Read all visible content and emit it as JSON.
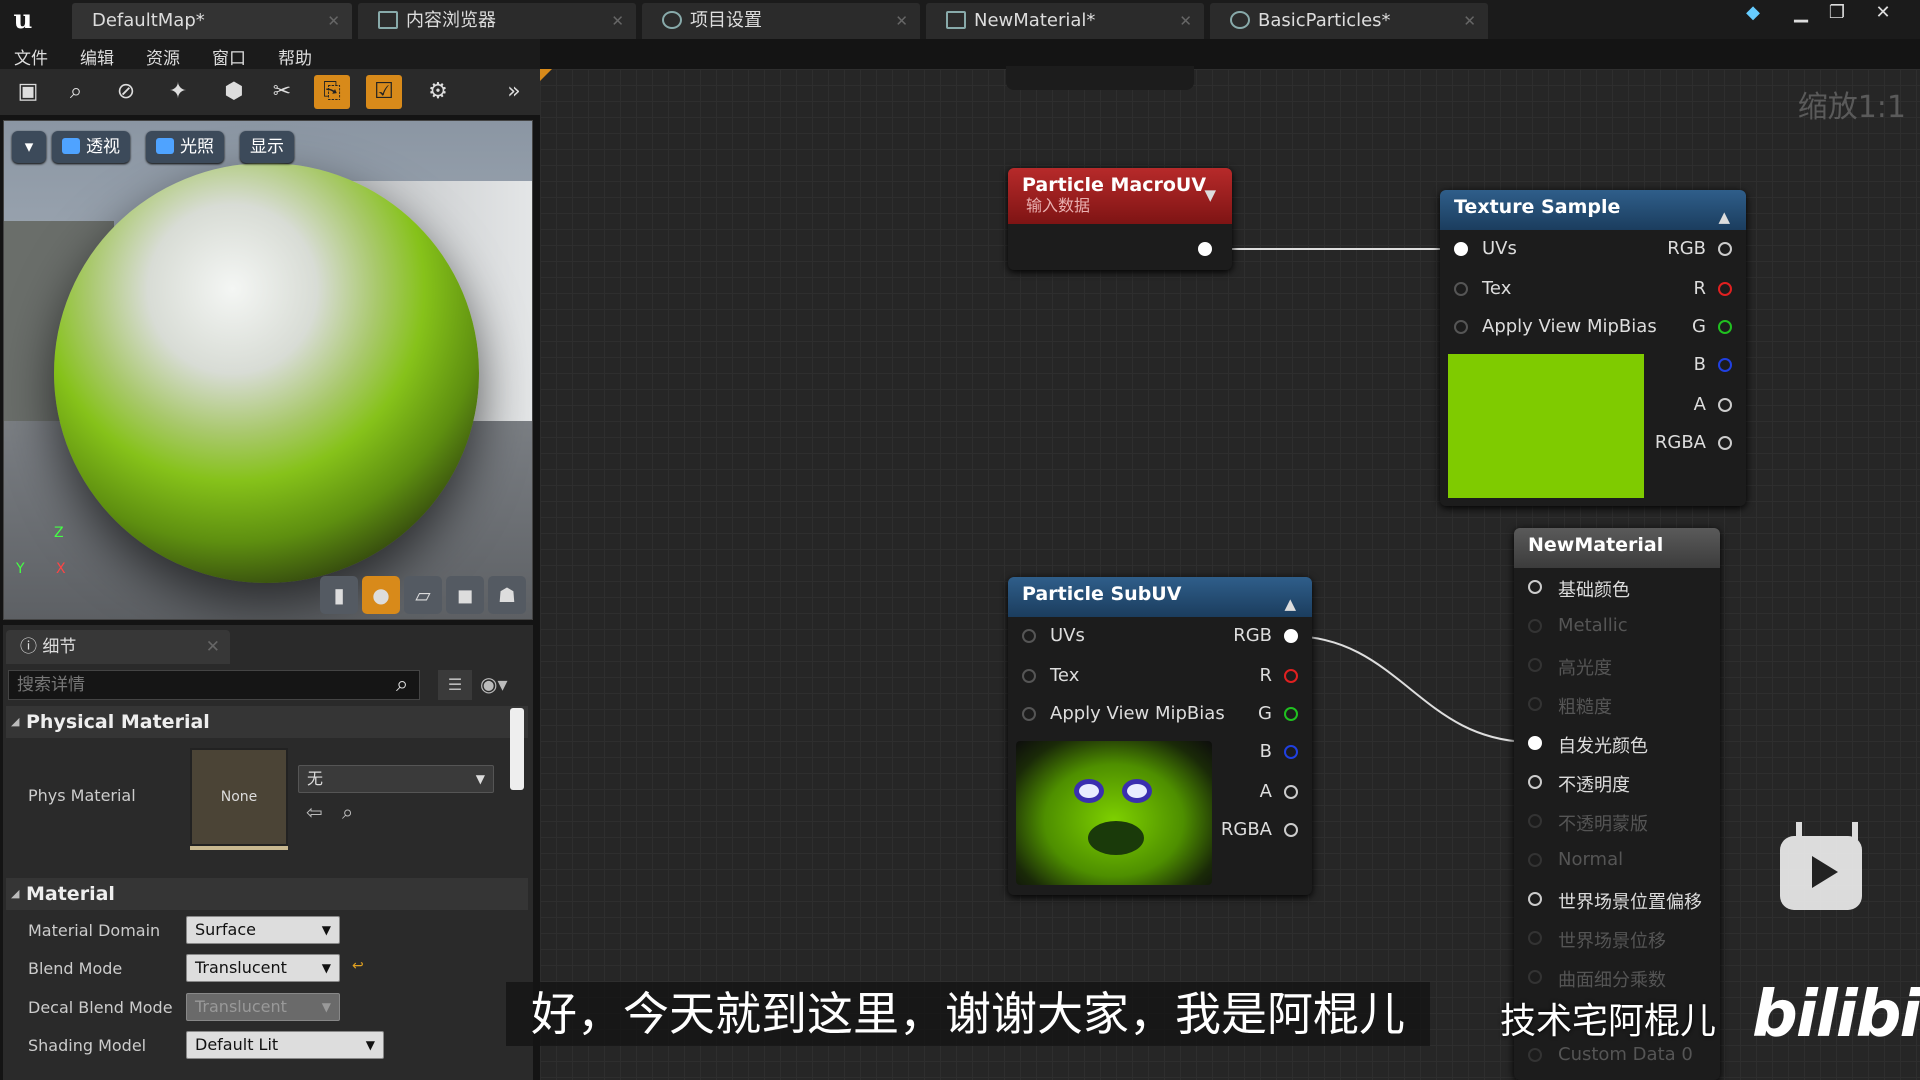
{
  "tabs": [
    {
      "label": "DefaultMap*",
      "icon": "map-icon"
    },
    {
      "label": "内容浏览器",
      "icon": "content-browser-icon"
    },
    {
      "label": "项目设置",
      "icon": "gear-icon"
    },
    {
      "label": "NewMaterial*",
      "icon": "material-icon"
    },
    {
      "label": "BasicParticles*",
      "icon": "particles-icon"
    }
  ],
  "menu": [
    "文件",
    "编辑",
    "资源",
    "窗口",
    "帮助"
  ],
  "viewport": {
    "perspective_label": "透视",
    "lighting_label": "光照",
    "show_label": "显示",
    "axis": {
      "z": "Z",
      "y": "Y",
      "x": "X"
    }
  },
  "details": {
    "tab_label": "细节",
    "search_placeholder": "搜索详情",
    "physical_section": "Physical Material",
    "phys_material_label": "Phys Material",
    "phys_thumb_text": "None",
    "phys_value": "无",
    "material_section": "Material",
    "props": [
      {
        "label": "Material Domain",
        "value": "Surface"
      },
      {
        "label": "Blend Mode",
        "value": "Translucent"
      },
      {
        "label": "Decal Blend Mode",
        "value": "Translucent"
      },
      {
        "label": "Shading Model",
        "value": "Default Lit"
      }
    ]
  },
  "graph": {
    "zoom": "缩放1:1",
    "macro_node": {
      "title": "Particle MacroUV",
      "subtitle": "输入数据"
    },
    "texture_node": {
      "title": "Texture Sample",
      "inputs": [
        "UVs",
        "Tex",
        "Apply View MipBias"
      ],
      "outputs": [
        "RGB",
        "R",
        "G",
        "B",
        "A",
        "RGBA"
      ],
      "preview_color": "#7fcb00"
    },
    "subuv_node": {
      "title": "Particle SubUV",
      "inputs": [
        "UVs",
        "Tex",
        "Apply View MipBias"
      ],
      "outputs": [
        "RGB",
        "R",
        "G",
        "B",
        "A",
        "RGBA"
      ]
    },
    "material_node": {
      "title": "NewMaterial",
      "pins": [
        "基础颜色",
        "Metallic",
        "高光度",
        "粗糙度",
        "自发光颜色",
        "不透明度",
        "不透明蒙版",
        "Normal",
        "世界场景位置偏移",
        "世界场景位移",
        "曲面细分乘数",
        "Custom Data 0"
      ]
    }
  },
  "overlay": {
    "subtitle": "好，今天就到这里，谢谢大家，我是阿棍儿",
    "watermark": "技术宅阿棍儿",
    "logo": "bilibili"
  }
}
